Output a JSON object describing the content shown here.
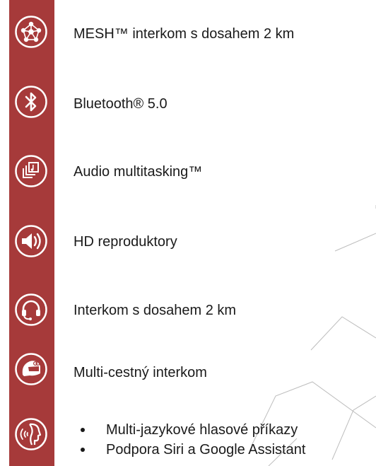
{
  "colors": {
    "bar": "#a63a3a",
    "icon_fg": "#ffffff",
    "text": "#1a1a1a",
    "decor_lines": "#bdbdbd"
  },
  "features": [
    {
      "icon": "mesh-network-icon",
      "text": "MESH™ interkom s dosahem 2 km"
    },
    {
      "icon": "bluetooth-icon",
      "text": "Bluetooth® 5.0"
    },
    {
      "icon": "audio-multitasking-icon",
      "text": "Audio multitasking™"
    },
    {
      "icon": "speaker-icon",
      "text": "HD reproduktory"
    },
    {
      "icon": "headset-icon",
      "text": "Interkom s dosahem 2 km"
    },
    {
      "icon": "helmet-icon",
      "text": "Multi-cestný interkom"
    }
  ],
  "voice": {
    "icon": "voice-command-icon",
    "bullets": [
      "Multi-jazykové hlasové příkazy",
      "Podpora Siri a Google Assistant"
    ]
  }
}
